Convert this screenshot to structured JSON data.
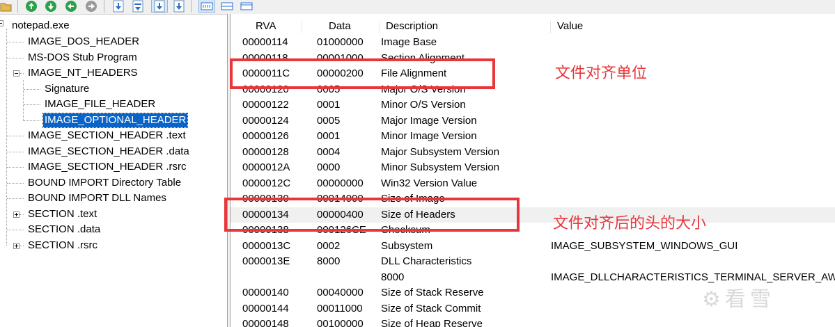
{
  "toolbar": {
    "buttons": [
      {
        "name": "open-folder-icon",
        "color": "#e8b84a"
      },
      {
        "name": "go-up-icon",
        "color": "#2aa14a"
      },
      {
        "name": "go-down-icon",
        "color": "#2aa14a"
      },
      {
        "name": "go-back-icon",
        "color": "#2aa14a"
      },
      {
        "name": "go-forward-icon",
        "color": "#9a9a9a"
      },
      {
        "name": "expand-icon",
        "color": "#2a6fd6"
      },
      {
        "name": "collapse-icon",
        "color": "#2a6fd6"
      },
      {
        "name": "expand-all-icon",
        "color": "#2a6fd6"
      },
      {
        "name": "collapse-all-icon",
        "color": "#2a6fd6"
      },
      {
        "name": "view-hex-icon",
        "color": "#2a6fd6"
      },
      {
        "name": "view-list-icon",
        "color": "#2a6fd6"
      },
      {
        "name": "view-detail-icon",
        "color": "#2a6fd6"
      }
    ]
  },
  "tree": {
    "root": "notepad.exe",
    "items": [
      {
        "label": "IMAGE_DOS_HEADER"
      },
      {
        "label": "MS-DOS Stub Program"
      },
      {
        "label": "IMAGE_NT_HEADERS"
      },
      {
        "label": "Signature"
      },
      {
        "label": "IMAGE_FILE_HEADER"
      },
      {
        "label": "IMAGE_OPTIONAL_HEADER"
      },
      {
        "label": "IMAGE_SECTION_HEADER .text"
      },
      {
        "label": "IMAGE_SECTION_HEADER .data"
      },
      {
        "label": "IMAGE_SECTION_HEADER .rsrc"
      },
      {
        "label": "BOUND IMPORT Directory Table"
      },
      {
        "label": "BOUND IMPORT DLL Names"
      },
      {
        "label": "SECTION .text"
      },
      {
        "label": "SECTION .data"
      },
      {
        "label": "SECTION .rsrc"
      }
    ]
  },
  "list": {
    "columns": [
      "RVA",
      "Data",
      "Description",
      "Value"
    ],
    "rows": [
      {
        "rva": "00000114",
        "data": "01000000",
        "desc": "Image Base",
        "value": ""
      },
      {
        "rva": "00000118",
        "data": "00001000",
        "desc": "Section Alignment",
        "value": ""
      },
      {
        "rva": "0000011C",
        "data": "00000200",
        "desc": "File Alignment",
        "value": ""
      },
      {
        "rva": "00000120",
        "data": "0005",
        "desc": "Major O/S Version",
        "value": ""
      },
      {
        "rva": "00000122",
        "data": "0001",
        "desc": "Minor O/S Version",
        "value": ""
      },
      {
        "rva": "00000124",
        "data": "0005",
        "desc": "Major Image Version",
        "value": ""
      },
      {
        "rva": "00000126",
        "data": "0001",
        "desc": "Minor Image Version",
        "value": ""
      },
      {
        "rva": "00000128",
        "data": "0004",
        "desc": "Major Subsystem Version",
        "value": ""
      },
      {
        "rva": "0000012A",
        "data": "0000",
        "desc": "Minor Subsystem Version",
        "value": ""
      },
      {
        "rva": "0000012C",
        "data": "00000000",
        "desc": "Win32 Version Value",
        "value": ""
      },
      {
        "rva": "00000130",
        "data": "00014000",
        "desc": "Size of Image",
        "value": ""
      },
      {
        "rva": "00000134",
        "data": "00000400",
        "desc": "Size of Headers",
        "value": ""
      },
      {
        "rva": "00000138",
        "data": "000126CE",
        "desc": "Checksum",
        "value": ""
      },
      {
        "rva": "0000013C",
        "data": "0002",
        "desc": "Subsystem",
        "value": "IMAGE_SUBSYSTEM_WINDOWS_GUI"
      },
      {
        "rva": "0000013E",
        "data": "8000",
        "desc": "DLL Characteristics",
        "value": ""
      },
      {
        "rva": "",
        "data": "",
        "desc": "8000",
        "value": "IMAGE_DLLCHARACTERISTICS_TERMINAL_SERVER_AWARE"
      },
      {
        "rva": "00000140",
        "data": "00040000",
        "desc": "Size of Stack Reserve",
        "value": ""
      },
      {
        "rva": "00000144",
        "data": "00011000",
        "desc": "Size of Stack Commit",
        "value": ""
      },
      {
        "rva": "00000148",
        "data": "00100000",
        "desc": "Size of Heap Reserve",
        "value": ""
      }
    ]
  },
  "annotations": {
    "file_alignment": "文件对齐单位",
    "size_of_headers": "文件对齐后的头的大小"
  },
  "watermark": "看雪",
  "colors": {
    "annotation": "#e8373b",
    "selection": "#0a64c8"
  }
}
